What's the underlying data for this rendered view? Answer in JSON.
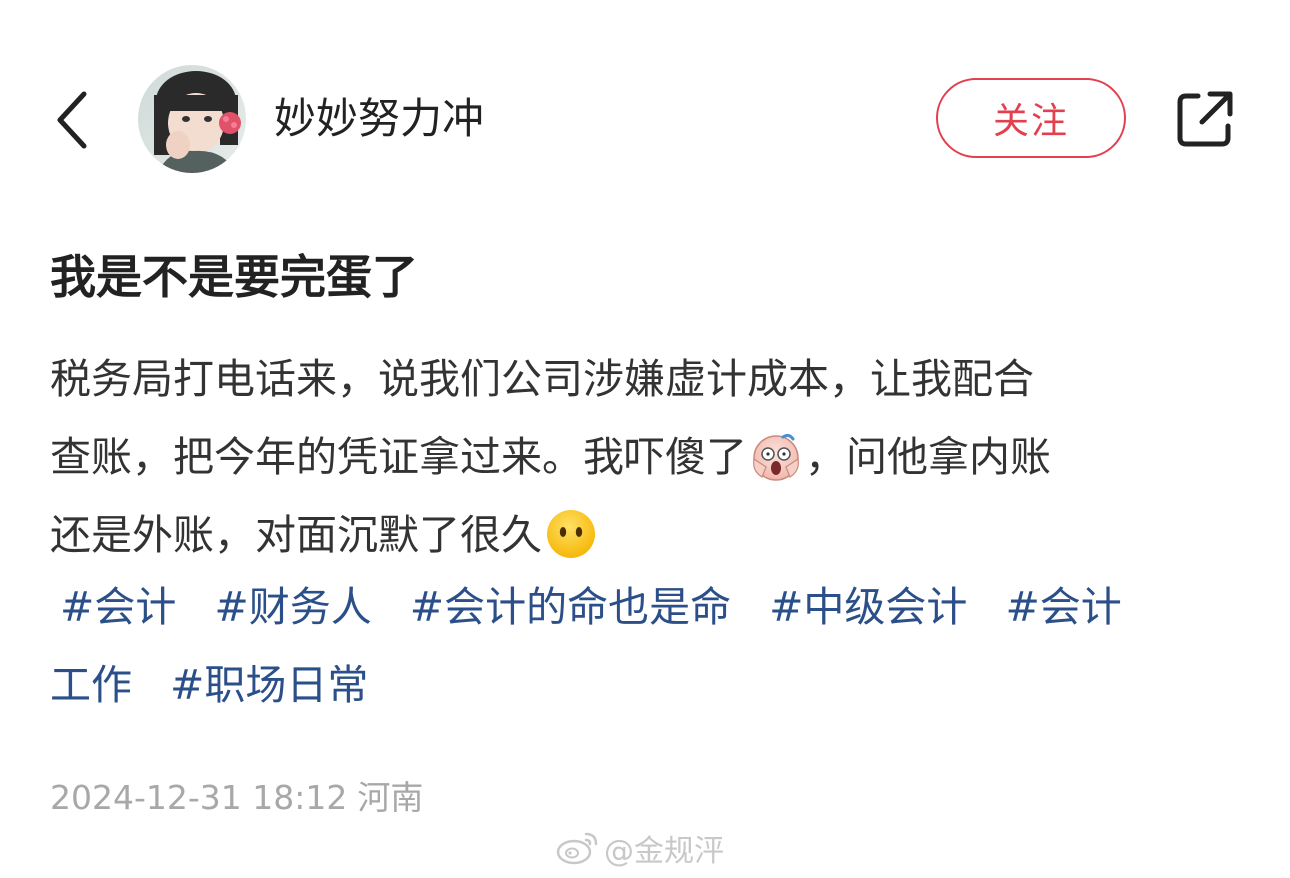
{
  "header": {
    "username": "妙妙努力冲",
    "follow_label": "关注",
    "back_icon": "chevron-left-icon",
    "share_icon": "share-icon"
  },
  "post": {
    "title": "我是不是要完蛋了",
    "body_lines": [
      {
        "before": "税务局打电话来，说我们公司涉嫌虚计成本，让我配合",
        "after": ""
      },
      {
        "before": "查账，把今年的凭证拿过来。我吓傻了",
        "emoji": "screaming-face-emoji",
        "after": "，问他拿内账"
      },
      {
        "before": "还是外账，对面沉默了很久",
        "emoji": "face-without-mouth-emoji",
        "after": ""
      }
    ],
    "tags": [
      "#会计",
      "#财务人",
      "#会计的命也是命",
      "#中级会计",
      "#会计",
      "工作",
      "#职场日常"
    ],
    "datetime": "2024-12-31 18:12",
    "location": "河南"
  },
  "watermark": {
    "text": "@金规泙",
    "icon": "weibo-logo-icon"
  },
  "colors": {
    "accent": "#e2404f",
    "tag": "#2b4f88",
    "meta": "#a8a8a8",
    "text": "#333333"
  }
}
